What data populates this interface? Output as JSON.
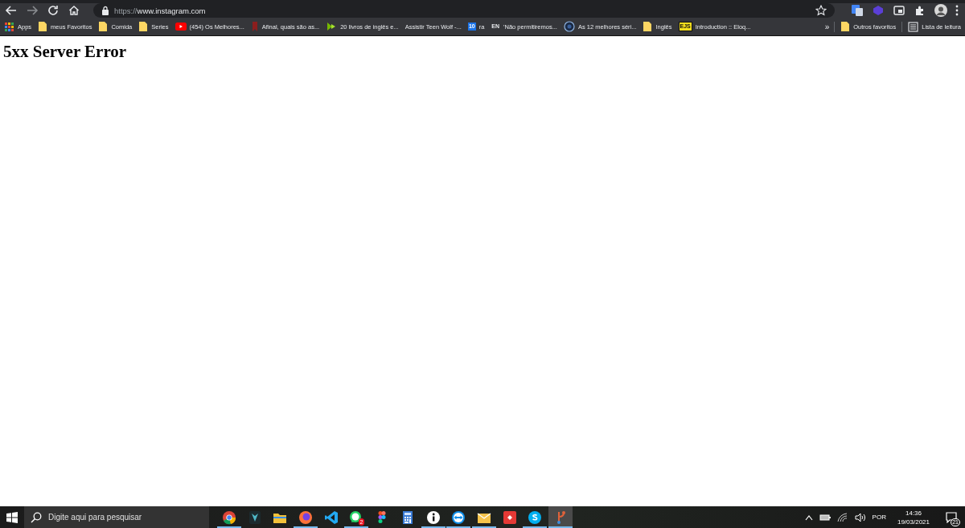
{
  "browser": {
    "url_scheme": "https://",
    "url_host": "www.instagram.com",
    "bookmarks": [
      {
        "kind": "apps",
        "label": "Apps"
      },
      {
        "kind": "folder",
        "label": "meus Favoritos"
      },
      {
        "kind": "folder",
        "label": "Comida"
      },
      {
        "kind": "folder",
        "label": "Series"
      },
      {
        "kind": "youtube",
        "label": "(454) Os Melhores..."
      },
      {
        "kind": "ribbon",
        "label": "Afinal, quais são as..."
      },
      {
        "kind": "arrow",
        "label": "20 livros de inglês e..."
      },
      {
        "kind": "blank",
        "label": "Assistir Teen Wolf -..."
      },
      {
        "kind": "calendar",
        "badge": "10",
        "label": "ra"
      },
      {
        "kind": "text",
        "badge": "EN",
        "label": "'Não permitiremos..."
      },
      {
        "kind": "globe",
        "label": "As 12 melhores séri..."
      },
      {
        "kind": "folder",
        "label": "Inglês"
      },
      {
        "kind": "ejs",
        "badge": "EJS",
        "label": "Introduction :: Eloq..."
      }
    ],
    "overflow": "»",
    "other_bookmarks": [
      {
        "kind": "folder",
        "label": "Outros favoritos"
      },
      {
        "kind": "list",
        "label": "Lista de leitura"
      }
    ]
  },
  "page": {
    "heading": "5xx Server Error"
  },
  "taskbar": {
    "search_placeholder": "Digite aqui para pesquisar",
    "apps": [
      {
        "kind": "chrome",
        "running": true,
        "selected": false
      },
      {
        "kind": "predator",
        "running": false,
        "selected": false
      },
      {
        "kind": "files",
        "running": false,
        "selected": false
      },
      {
        "kind": "firefox",
        "running": true,
        "selected": false
      },
      {
        "kind": "vscode",
        "running": false,
        "selected": false
      },
      {
        "kind": "whatsapp",
        "running": true,
        "selected": false,
        "badge": "2"
      },
      {
        "kind": "figma",
        "running": false,
        "selected": false
      },
      {
        "kind": "calculator",
        "running": false,
        "selected": false
      },
      {
        "kind": "info",
        "running": true,
        "selected": false
      },
      {
        "kind": "teamviewer",
        "running": true,
        "selected": false
      },
      {
        "kind": "mail",
        "running": true,
        "selected": false
      },
      {
        "kind": "redapp",
        "running": false,
        "selected": false
      },
      {
        "kind": "skype",
        "running": true,
        "selected": false
      },
      {
        "kind": "git",
        "running": true,
        "selected": true
      }
    ],
    "language": "POR",
    "time": "14:36",
    "date": "19/03/2021",
    "notifications": "21"
  }
}
